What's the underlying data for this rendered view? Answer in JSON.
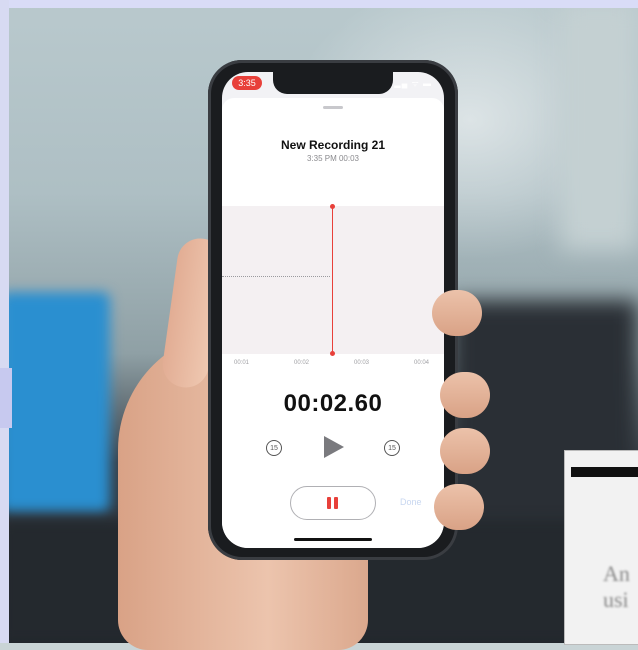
{
  "status_bar": {
    "time": "3:35",
    "icons": "▂▄ ᯤ ▬"
  },
  "recording": {
    "title": "New Recording 21",
    "subtitle": "3:35 PM  00:03"
  },
  "timeline": {
    "ticks": [
      "00:01",
      "00:02",
      "00:03",
      "00:04"
    ]
  },
  "timer": "00:02.60",
  "controls": {
    "skip_back": "15",
    "skip_forward": "15",
    "done_label": "Done"
  },
  "colors": {
    "accent": "#e8403a",
    "background_blue": "#2a8fd0"
  },
  "icons": {
    "play": "play-icon",
    "pause": "pause-icon",
    "skip_back": "skip-back-15-icon",
    "skip_forward": "skip-forward-15-icon"
  },
  "corner_thumbnail": {
    "text": "An\nusi"
  }
}
